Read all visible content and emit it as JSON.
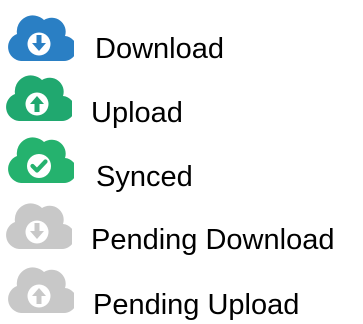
{
  "legend": {
    "items": [
      {
        "label": "Download",
        "icon": "cloud-download-icon",
        "color": "#2a7fc4"
      },
      {
        "label": "Upload",
        "icon": "cloud-upload-icon",
        "color": "#20a86f"
      },
      {
        "label": "Synced",
        "icon": "cloud-synced-icon",
        "color": "#25b26e"
      },
      {
        "label": "Pending Download",
        "icon": "cloud-pending-download-icon",
        "color": "#c8c8c8"
      },
      {
        "label": "Pending Upload",
        "icon": "cloud-pending-upload-icon",
        "color": "#c8c8c8"
      }
    ]
  }
}
